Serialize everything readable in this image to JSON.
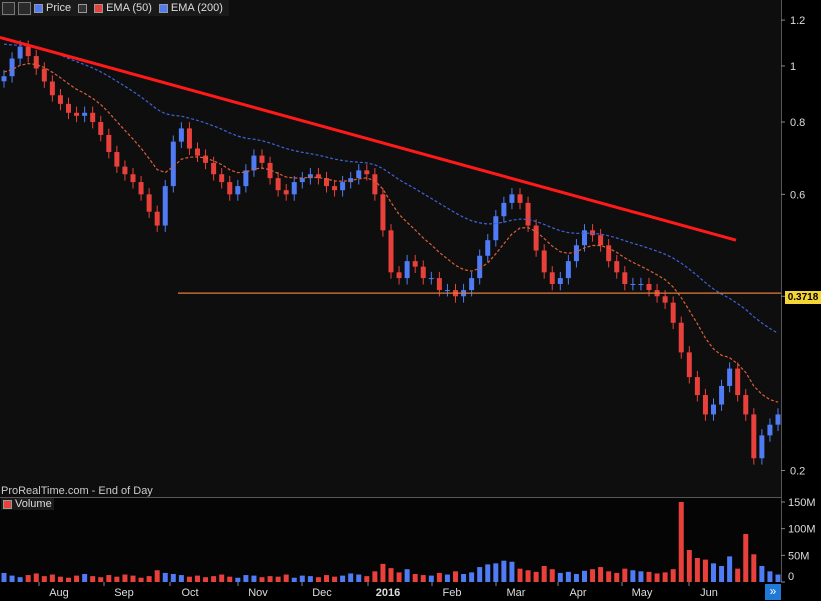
{
  "toolbar": {
    "price_label": "Price",
    "ema50_label": "EMA (50)",
    "ema200_label": "EMA (200)"
  },
  "watermark": "ProRealTime.com - End of Day",
  "volume_label": "Volume",
  "current_price": "0.3718",
  "colors": {
    "bull": "#4f7cf5",
    "bear": "#e8413c",
    "ema50": "#d9603a",
    "ema200": "#3d63d6",
    "trend": "#ff1a1a",
    "support": "#e07b3a"
  },
  "chart_data": [
    {
      "type": "candlestick",
      "title": "",
      "x_ticks": [
        "Aug",
        "Sep",
        "Oct",
        "Nov",
        "Dec",
        "2016",
        "Feb",
        "Mar",
        "Apr",
        "May",
        "Jun"
      ],
      "y_scale": "log",
      "y_ticks": [
        0.2,
        0.4,
        0.6,
        0.8,
        1,
        1.2
      ],
      "ylim": [
        0.18,
        1.3
      ],
      "series": [
        {
          "name": "Price",
          "close": [
            0.96,
            1.03,
            1.08,
            1.04,
            0.99,
            0.94,
            0.89,
            0.86,
            0.83,
            0.82,
            0.83,
            0.8,
            0.76,
            0.71,
            0.67,
            0.65,
            0.63,
            0.6,
            0.56,
            0.53,
            0.62,
            0.74,
            0.78,
            0.72,
            0.7,
            0.68,
            0.65,
            0.63,
            0.6,
            0.62,
            0.66,
            0.7,
            0.68,
            0.64,
            0.61,
            0.6,
            0.63,
            0.64,
            0.65,
            0.64,
            0.62,
            0.61,
            0.63,
            0.64,
            0.66,
            0.65,
            0.6,
            0.52,
            0.44,
            0.43,
            0.46,
            0.45,
            0.43,
            0.43,
            0.41,
            0.41,
            0.4,
            0.41,
            0.43,
            0.47,
            0.5,
            0.55,
            0.58,
            0.6,
            0.58,
            0.53,
            0.48,
            0.44,
            0.42,
            0.43,
            0.46,
            0.49,
            0.52,
            0.51,
            0.49,
            0.46,
            0.44,
            0.42,
            0.42,
            0.42,
            0.41,
            0.4,
            0.39,
            0.36,
            0.32,
            0.29,
            0.27,
            0.25,
            0.26,
            0.28,
            0.3,
            0.27,
            0.25,
            0.21,
            0.23,
            0.24,
            0.25
          ]
        },
        {
          "name": "EMA (50)"
        },
        {
          "name": "EMA (200)"
        }
      ],
      "trendline": {
        "from": [
          "start",
          1.12
        ],
        "to": [
          "end of May",
          0.5
        ]
      },
      "support": 0.405,
      "last": 0.3718
    },
    {
      "type": "bar",
      "name": "Volume",
      "y_ticks": [
        "0",
        "50M",
        "100M",
        "150M"
      ],
      "ylim": [
        0,
        150
      ],
      "values": [
        17,
        12,
        9,
        13,
        16,
        11,
        14,
        10,
        8,
        12,
        15,
        11,
        9,
        13,
        10,
        14,
        12,
        8,
        11,
        22,
        17,
        15,
        13,
        10,
        12,
        9,
        11,
        14,
        10,
        8,
        13,
        12,
        9,
        11,
        10,
        14,
        8,
        12,
        11,
        9,
        13,
        10,
        12,
        16,
        14,
        11,
        20,
        34,
        26,
        18,
        24,
        15,
        13,
        12,
        17,
        14,
        20,
        15,
        18,
        28,
        33,
        35,
        40,
        38,
        25,
        22,
        19,
        30,
        24,
        17,
        19,
        15,
        21,
        24,
        28,
        20,
        17,
        25,
        22,
        20,
        19,
        16,
        18,
        24,
        150,
        60,
        45,
        42,
        35,
        30,
        48,
        25,
        90,
        52,
        30,
        20,
        14
      ]
    }
  ]
}
